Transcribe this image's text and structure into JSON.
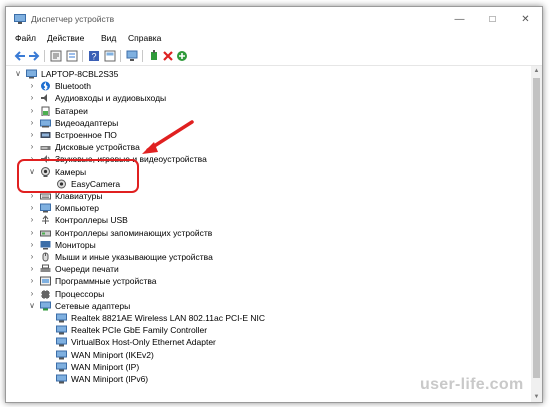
{
  "window": {
    "title": "Диспетчер устройств"
  },
  "menu": [
    "Файл",
    "Действие",
    "Вид",
    "Справка"
  ],
  "toolbar_icons": [
    "back-icon",
    "forward-icon",
    "properties-icon",
    "list-icon",
    "help-icon",
    "toggle-view-icon",
    "monitor-icon",
    "update-driver-icon",
    "remove-icon",
    "add-icon"
  ],
  "tree": {
    "root": "LAPTOP-8CBL2S35",
    "categories": [
      {
        "label": "Bluetooth",
        "icon": "bluetooth-icon"
      },
      {
        "label": "Аудиовходы и аудиовыходы",
        "icon": "audio-icon"
      },
      {
        "label": "Батареи",
        "icon": "battery-icon"
      },
      {
        "label": "Видеоадаптеры",
        "icon": "display-adapter-icon"
      },
      {
        "label": "Встроенное ПО",
        "icon": "firmware-icon"
      },
      {
        "label": "Дисковые устройства",
        "icon": "disk-icon"
      },
      {
        "label": "Звуковые, игровые и видеоустройства",
        "icon": "sound-icon"
      },
      {
        "label": "Камеры",
        "icon": "camera-icon",
        "expanded": true,
        "children": [
          "EasyCamera"
        ]
      },
      {
        "label": "Клавиатуры",
        "icon": "keyboard-icon"
      },
      {
        "label": "Компьютер",
        "icon": "computer-icon"
      },
      {
        "label": "Контроллеры USB",
        "icon": "usb-icon"
      },
      {
        "label": "Контроллеры запоминающих устройств",
        "icon": "storage-controller-icon"
      },
      {
        "label": "Мониторы",
        "icon": "monitor-icon"
      },
      {
        "label": "Мыши и иные указывающие устройства",
        "icon": "mouse-icon"
      },
      {
        "label": "Очереди печати",
        "icon": "printer-icon"
      },
      {
        "label": "Программные устройства",
        "icon": "software-device-icon"
      },
      {
        "label": "Процессоры",
        "icon": "processor-icon"
      },
      {
        "label": "Сетевые адаптеры",
        "icon": "network-icon",
        "expanded": true,
        "children": [
          "Realtek 8821AE Wireless LAN 802.11ac PCI-E NIC",
          "Realtek PCIe GbE Family Controller",
          "VirtualBox Host-Only Ethernet Adapter",
          "WAN Miniport (IKEv2)",
          "WAN Miniport (IP)",
          "WAN Miniport (IPv6)"
        ]
      }
    ]
  },
  "watermark": "user-life.com",
  "colors": {
    "annotation": "#e02020",
    "accent": "#1e6fd0"
  }
}
